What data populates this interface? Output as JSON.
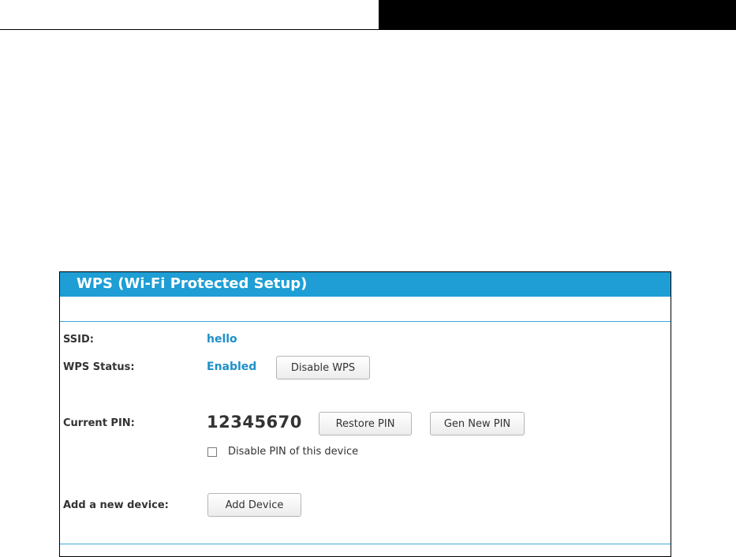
{
  "panel": {
    "title": "WPS (Wi-Fi Protected Setup)",
    "accent_color": "#1e9ed4"
  },
  "ssid": {
    "label": "SSID:",
    "value": "hello"
  },
  "wps_status": {
    "label": "WPS Status:",
    "value": "Enabled",
    "button_label": "Disable WPS"
  },
  "current_pin": {
    "label": "Current PIN:",
    "value": "12345670",
    "restore_label": "Restore PIN",
    "gen_label": "Gen New PIN",
    "disable_checkbox_label": "Disable PIN of this device",
    "disable_checked": false
  },
  "add_device": {
    "label": "Add a new device:",
    "button_label": "Add Device"
  }
}
